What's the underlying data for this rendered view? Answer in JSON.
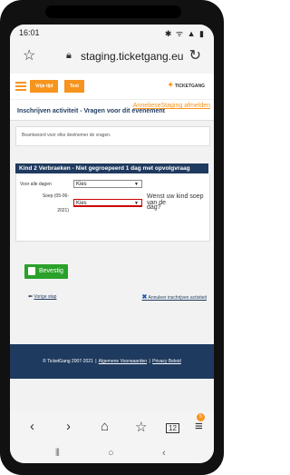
{
  "status": {
    "time": "16:01",
    "icons": "✱ ᯤ ▲ ▮"
  },
  "browser": {
    "url": "staging.ticketgang.eu"
  },
  "site": {
    "crumbs": [
      "Vrije tijd",
      "Test"
    ],
    "logo_mark": "✦",
    "logo_text": "TICKETGANG"
  },
  "page": {
    "title": "Inschrijven activiteit - Vragen voor dit evenement",
    "logout": "AnnelieseStaging afmelden",
    "info": "Beantwoord voor elke deelnemer de vragen."
  },
  "kind": {
    "header": "Kind 2 Verbraeken - Niet gegroepeerd 1 dag met opvolgvraag",
    "all_days_label": "Voor alle dagen",
    "all_days_value": "Kies",
    "date_label_line1": "Soep (05-06-",
    "date_label_line2": "2021)",
    "date_value": "Kies",
    "question_line1": "Wenst uw kind soep van de",
    "question_line2": "dag?"
  },
  "actions": {
    "confirm": "Bevestig",
    "previous": "Vorige stap",
    "cancel": "Annuleer inschrijven activiteit"
  },
  "footer": {
    "copyright": "© TicketGang 2007-2021",
    "terms": "Algemene Voorwaarden",
    "privacy": "Privacy Beleid",
    "separator": "|"
  },
  "navbar": {
    "tabs_badge": "5",
    "tabs_count": "12"
  },
  "colors": {
    "accent": "#f7941d",
    "navy": "#1f3a5f",
    "green": "#2aa12a",
    "error": "#c00000"
  }
}
